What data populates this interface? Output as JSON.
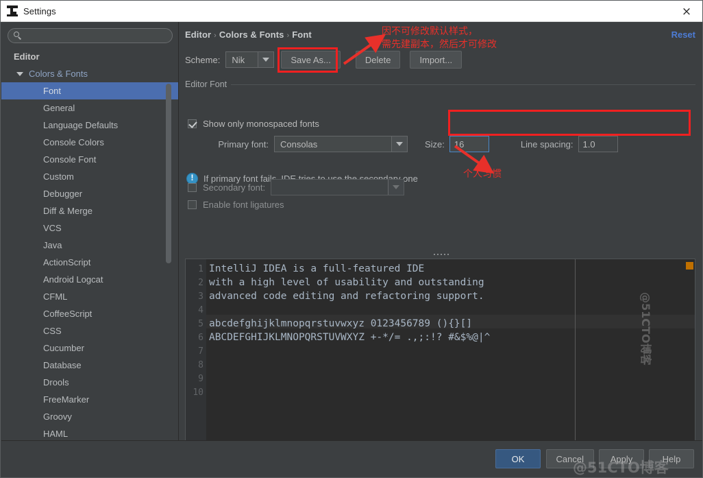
{
  "window": {
    "title": "Settings",
    "logo_icon": "intellij-logo-icon",
    "close_icon": "×"
  },
  "sidebar": {
    "search": {
      "value": "",
      "placeholder": "",
      "icon": "search-icon"
    },
    "items": [
      {
        "label": "Editor",
        "level": 0,
        "selected": false,
        "twisty": false
      },
      {
        "label": "Colors & Fonts",
        "level": 1,
        "selected": false,
        "twisty": true
      },
      {
        "label": "Font",
        "level": 2,
        "selected": true,
        "twisty": false
      },
      {
        "label": "General",
        "level": 2,
        "selected": false,
        "twisty": false
      },
      {
        "label": "Language Defaults",
        "level": 2,
        "selected": false,
        "twisty": false
      },
      {
        "label": "Console Colors",
        "level": 2,
        "selected": false,
        "twisty": false
      },
      {
        "label": "Console Font",
        "level": 2,
        "selected": false,
        "twisty": false
      },
      {
        "label": "Custom",
        "level": 2,
        "selected": false,
        "twisty": false
      },
      {
        "label": "Debugger",
        "level": 2,
        "selected": false,
        "twisty": false
      },
      {
        "label": "Diff & Merge",
        "level": 2,
        "selected": false,
        "twisty": false
      },
      {
        "label": "VCS",
        "level": 2,
        "selected": false,
        "twisty": false
      },
      {
        "label": "Java",
        "level": 2,
        "selected": false,
        "twisty": false
      },
      {
        "label": "ActionScript",
        "level": 2,
        "selected": false,
        "twisty": false
      },
      {
        "label": "Android Logcat",
        "level": 2,
        "selected": false,
        "twisty": false
      },
      {
        "label": "CFML",
        "level": 2,
        "selected": false,
        "twisty": false
      },
      {
        "label": "CoffeeScript",
        "level": 2,
        "selected": false,
        "twisty": false
      },
      {
        "label": "CSS",
        "level": 2,
        "selected": false,
        "twisty": false
      },
      {
        "label": "Cucumber",
        "level": 2,
        "selected": false,
        "twisty": false
      },
      {
        "label": "Database",
        "level": 2,
        "selected": false,
        "twisty": false
      },
      {
        "label": "Drools",
        "level": 2,
        "selected": false,
        "twisty": false
      },
      {
        "label": "FreeMarker",
        "level": 2,
        "selected": false,
        "twisty": false
      },
      {
        "label": "Groovy",
        "level": 2,
        "selected": false,
        "twisty": false
      },
      {
        "label": "HAML",
        "level": 2,
        "selected": false,
        "twisty": false
      }
    ]
  },
  "content": {
    "breadcrumb": [
      "Editor",
      "Colors & Fonts",
      "Font"
    ],
    "breadcrumb_separator": "›",
    "reset_label": "Reset",
    "scheme": {
      "label": "Scheme:",
      "value": "Nik",
      "dropdown_icon": "chevron-down-icon",
      "save_as_label": "Save As...",
      "delete_label": "Delete",
      "import_label": "Import..."
    },
    "editor_font": {
      "group_title": "Editor Font",
      "show_monospaced": {
        "label": "Show only monospaced fonts",
        "checked": true
      },
      "primary_font": {
        "label": "Primary font:",
        "value": "Consolas"
      },
      "size": {
        "label": "Size:",
        "value": "16"
      },
      "line_spacing": {
        "label": "Line spacing:",
        "value": "1.0"
      },
      "hint": "If primary font fails, IDE tries to use the secondary one",
      "hint_icon": "info-icon",
      "secondary_font": {
        "label": "Secondary font:",
        "value": "",
        "checked": false
      },
      "ligatures": {
        "label": "Enable font ligatures",
        "checked": false
      }
    }
  },
  "preview": {
    "line_numbers": [
      "1",
      "2",
      "3",
      "4",
      "5",
      "6",
      "7",
      "8",
      "9",
      "10"
    ],
    "lines": [
      "IntelliJ IDEA is a full-featured IDE",
      "with a high level of usability and outstanding",
      "advanced code editing and refactoring support.",
      "",
      "abcdefghijklmnopqrstuvwxyz 0123456789 (){}[]",
      "ABCDEFGHIJKLMNOPQRSTUVWXYZ +-*/= .,;:!? #&$%@|^",
      "",
      "",
      "",
      ""
    ]
  },
  "footer": {
    "ok_label": "OK",
    "cancel_label": "Cancel",
    "apply_label": "Apply",
    "help_label": "Help"
  },
  "annotations": {
    "scheme_note": "因不可修改默认样式，\n需先建副本，然后才可修改",
    "font_note": "个人习惯",
    "color": "#e8302a"
  },
  "watermarks": {
    "bottom": "@51CTO博客",
    "right": "@51CTO博客"
  }
}
